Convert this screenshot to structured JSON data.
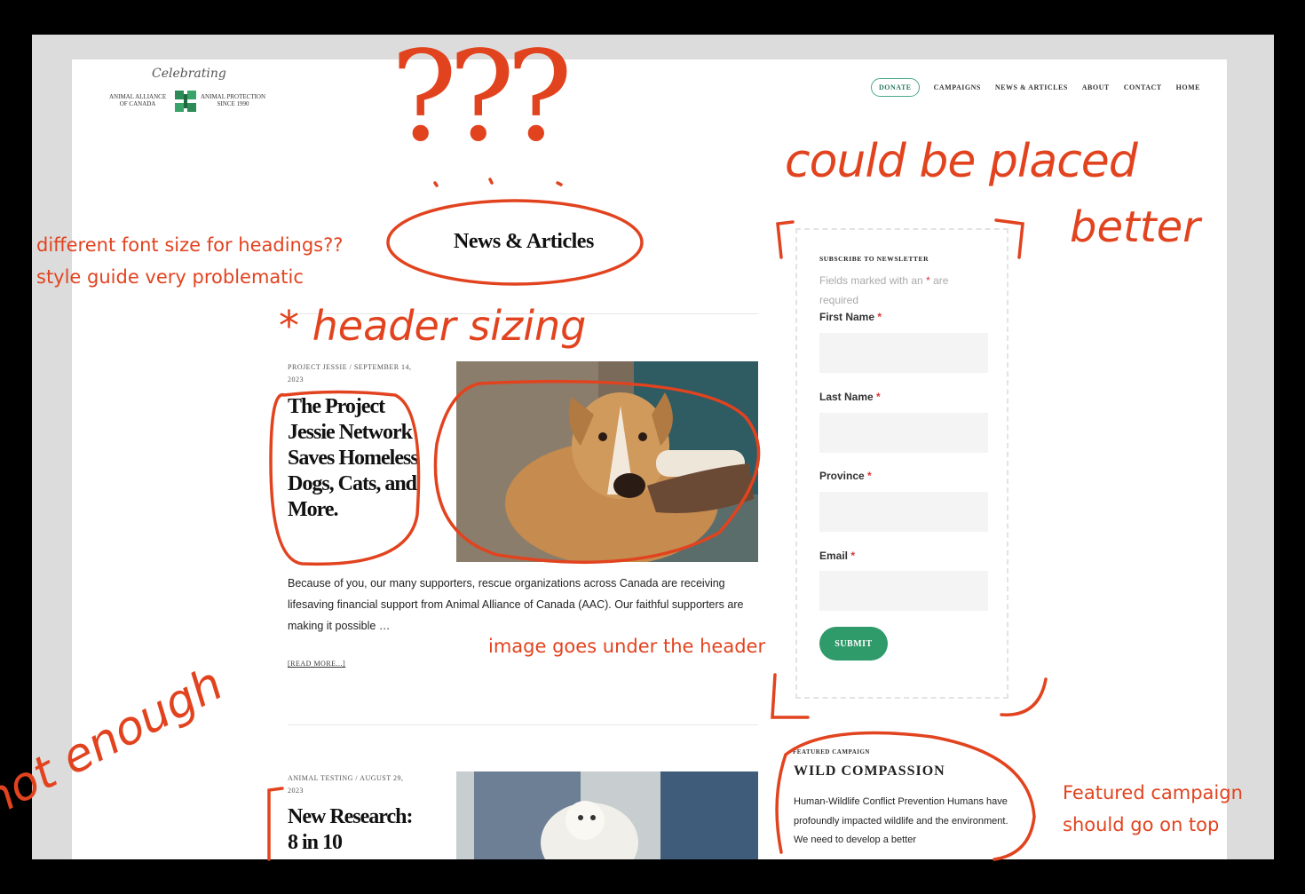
{
  "logo": {
    "celebrating": "Celebrating",
    "left_line1": "ANIMAL ALLIANCE",
    "left_line2": "OF CANADA",
    "right_line1": "ANIMAL PROTECTION",
    "right_line2": "SINCE 1990"
  },
  "nav": {
    "items": [
      {
        "label": "DONATE"
      },
      {
        "label": "CAMPAIGNS"
      },
      {
        "label": "NEWS & ARTICLES"
      },
      {
        "label": "ABOUT"
      },
      {
        "label": "CONTACT"
      },
      {
        "label": "HOME"
      }
    ]
  },
  "page_title": "News & Articles",
  "posts": [
    {
      "meta_line1": "PROJECT JESSIE / SEPTEMBER 14,",
      "meta_line2": "2023",
      "title": "The Project Jessie Network Saves Homeless Dogs, Cats, and More.",
      "excerpt": "Because of you, our many supporters, rescue organizations across Canada are receiving lifesaving financial support from Animal Alliance of Canada (AAC). Our faithful supporters are making it possible …",
      "read_more": "[READ MORE...]"
    },
    {
      "meta_line1": "ANIMAL TESTING / AUGUST 29,",
      "meta_line2": "2023",
      "title": "New Research: 8 in 10"
    }
  ],
  "newsletter": {
    "heading": "SUBSCRIBE TO NEWSLETTER",
    "note_prefix": "Fields marked with an",
    "note_star": "*",
    "note_suffix": "are required",
    "fields": [
      {
        "label": "First Name",
        "star": "*"
      },
      {
        "label": "Last Name",
        "star": "*"
      },
      {
        "label": "Province",
        "star": "*"
      },
      {
        "label": "Email",
        "star": "*"
      }
    ],
    "submit_label": "SUBMIT"
  },
  "featured": {
    "label": "FEATURED CAMPAIGN",
    "title": "WILD COMPASSION",
    "text": "Human-Wildlife Conflict Prevention Humans have profoundly impacted wildlife and the environment.  We need to develop a better"
  },
  "annotations": {
    "question_marks": "???",
    "could_be_placed": "could be placed",
    "better": "better",
    "headings_line1": "different font size for headings??",
    "headings_line2": "style guide very problematic",
    "header_sizing": "* header sizing",
    "image_under_header": "image goes under the header",
    "featured_line1": "Featured campaign",
    "featured_line2": "should go on top",
    "not_enough": "not enough"
  },
  "colors": {
    "annotation": "#e2431f",
    "accent_green": "#2f9a6a",
    "required_red": "#d33"
  }
}
